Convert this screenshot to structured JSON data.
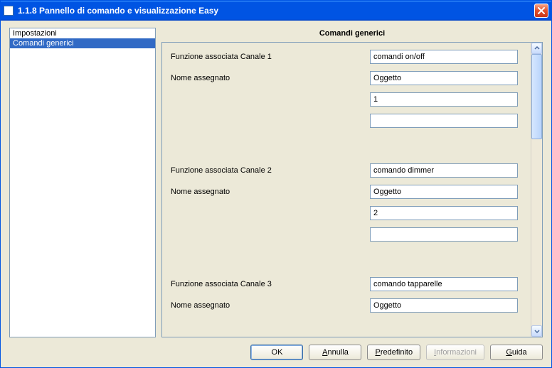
{
  "window": {
    "title": "1.1.8 Pannello di comando e visualizzazione Easy"
  },
  "sidebar": {
    "items": [
      {
        "label": "Impostazioni",
        "selected": false
      },
      {
        "label": "Comandi generici",
        "selected": true
      }
    ]
  },
  "main": {
    "heading": "Comandi generici",
    "rows": [
      {
        "label": "Funzione associata Canale 1",
        "value": "comandi on/off",
        "type": "select"
      },
      {
        "label": "Nome assegnato",
        "value": "Oggetto",
        "type": "select"
      },
      {
        "label": "",
        "value": "1",
        "type": "select"
      },
      {
        "label": "",
        "value": "",
        "type": "select"
      },
      {
        "gap": true
      },
      {
        "label": "Funzione associata Canale 2",
        "value": "comando dimmer",
        "type": "select"
      },
      {
        "label": "Nome assegnato",
        "value": "Oggetto",
        "type": "select"
      },
      {
        "label": "",
        "value": "2",
        "type": "select"
      },
      {
        "label": "",
        "value": "",
        "type": "select"
      },
      {
        "gap": true
      },
      {
        "label": "Funzione associata Canale 3",
        "value": "comando tapparelle",
        "type": "select"
      },
      {
        "label": "Nome assegnato",
        "value": "Oggetto",
        "type": "select"
      }
    ],
    "scroll": {
      "thumbTop": 0,
      "thumbHeight": 120
    }
  },
  "buttons": {
    "ok": "OK",
    "cancel_pre": "",
    "cancel_u": "A",
    "cancel_post": "nnulla",
    "default_pre": "",
    "default_u": "P",
    "default_post": "redefinito",
    "info_pre": "",
    "info_u": "I",
    "info_post": "nformazioni",
    "help_pre": "",
    "help_u": "G",
    "help_post": "uida"
  }
}
